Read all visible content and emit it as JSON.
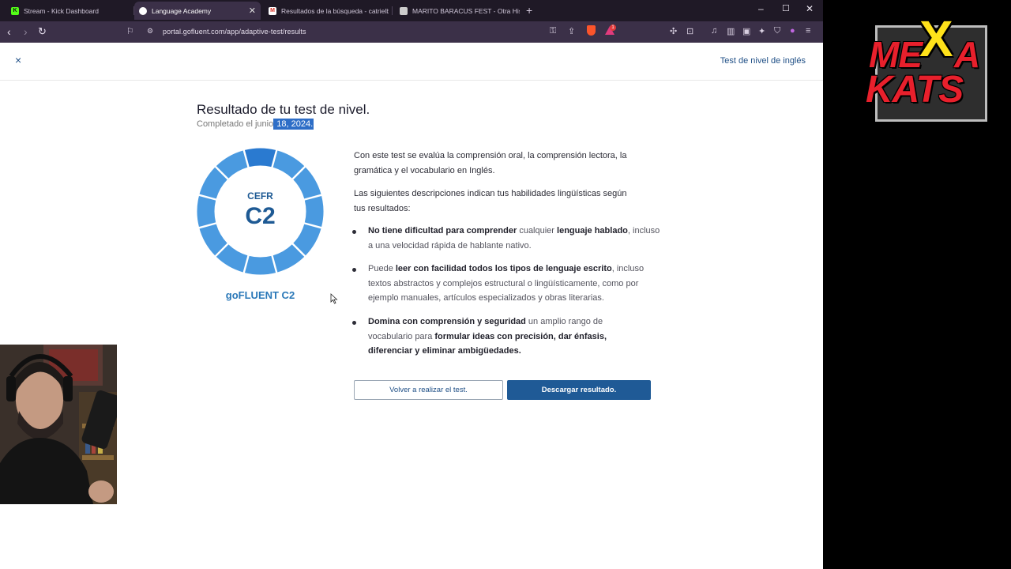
{
  "browser": {
    "tabs": [
      {
        "label": "Stream - Kick Dashboard",
        "active": false
      },
      {
        "label": "Language Academy",
        "active": true
      },
      {
        "label": "Resultados de la búsqueda - catrielb",
        "active": false
      },
      {
        "label": "MARITO BARACUS FEST - Otra Histori",
        "active": false
      }
    ],
    "url": "portal.gofluent.com/app/adaptive-test/results",
    "rewards_badge": "1"
  },
  "header": {
    "close_symbol": "×",
    "title": "Test de nivel de inglés"
  },
  "result": {
    "title": "Resultado de tu test de nivel.",
    "completed_prefix": "Completado el junio",
    "completed_date": " 18, 2024."
  },
  "level": {
    "framework": "CEFR",
    "value": "C2",
    "caption": "goFLUENT C2",
    "segments_total": 12,
    "segments_highlighted": 1
  },
  "description": {
    "intro": "Con este test se evalúa la comprensión oral, la comprensión lectora, la gramática y el vocabulario en Inglés.",
    "skills_intro": "Las siguientes descripciones indican tus habilidades lingüísticas según tus resultados:",
    "bullets": [
      {
        "p1b": "No tiene dificultad para comprender",
        "p2": " cualquier ",
        "p3b": "lenguaje hablado",
        "p4": ", incluso a una velocidad rápida de hablante nativo."
      },
      {
        "p1": "Puede ",
        "p2b": "leer con facilidad todos los tipos de lenguaje escrito",
        "p3": ", incluso textos abstractos y complejos estructural o lingüísticamente, como por ejemplo manuales, artículos especializados y obras literarias."
      },
      {
        "p1b": "Domina con comprensión y seguridad",
        "p2": " un amplio rango de vocabulario para ",
        "p3b": "formular ideas con precisión, dar énfasis, diferenciar y eliminar ambigüedades."
      }
    ]
  },
  "actions": {
    "retake": "Volver a realizar el test.",
    "download": "Descargar resultado."
  },
  "colors": {
    "primary": "#1f5a96",
    "donut_light": "#4a9ae0",
    "donut_dark": "#2a7ad0"
  },
  "overlay": {
    "logo_line1": "ME",
    "logo_x": "X",
    "logo_a": "A",
    "logo_line2": "KATS"
  }
}
